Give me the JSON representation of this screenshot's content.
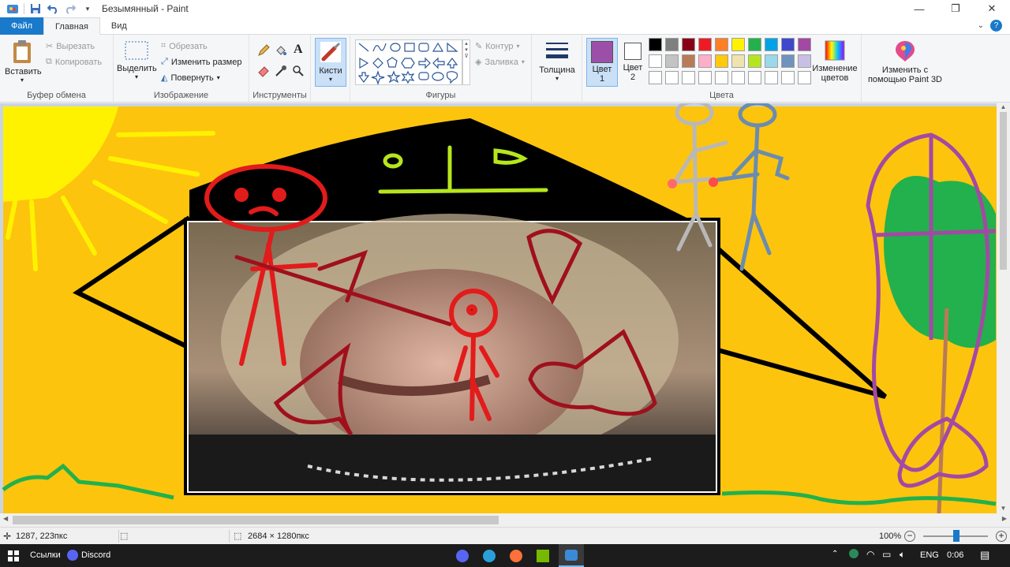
{
  "window": {
    "title": "Безымянный - Paint"
  },
  "tabs": [
    "Файл",
    "Главная",
    "Вид"
  ],
  "ribbon": {
    "clipboard": {
      "paste": "Вставить",
      "cut": "Вырезать",
      "copy": "Копировать",
      "label": "Буфер обмена"
    },
    "image": {
      "select": "Выделить",
      "crop": "Обрезать",
      "resize": "Изменить размер",
      "rotate": "Повернуть",
      "label": "Изображение"
    },
    "tools": {
      "label": "Инструменты"
    },
    "brushes": {
      "label": "Кисти"
    },
    "shapes": {
      "outline": "Контур",
      "fill": "Заливка",
      "label": "Фигуры"
    },
    "size": {
      "label": "Толщина"
    },
    "colors": {
      "color1": "Цвет 1",
      "color2": "Цвет 2",
      "edit": "Изменение цветов",
      "label": "Цвета",
      "color1_value": "#9c4fa8",
      "color2_value": "#ffffff",
      "palette_row1": [
        "#000000",
        "#7f7f7f",
        "#880015",
        "#ed1c24",
        "#ff7f27",
        "#fff200",
        "#22b14c",
        "#00a2e8",
        "#3f48cc",
        "#a349a4"
      ],
      "palette_row2": [
        "#ffffff",
        "#c3c3c3",
        "#b97a57",
        "#ffaec9",
        "#ffc90e",
        "#efe4b0",
        "#b5e61d",
        "#99d9ea",
        "#7092be",
        "#c8bfe7"
      ]
    },
    "paint3d": {
      "label": "Изменить с помощью Paint 3D"
    }
  },
  "status": {
    "cursor": "1287, 223пкс",
    "canvas_size": "2684 × 1280пкс",
    "zoom": "100%"
  },
  "taskbar": {
    "links": "Ссылки",
    "discord": "Discord",
    "lang": "ENG",
    "time": "0:06"
  }
}
